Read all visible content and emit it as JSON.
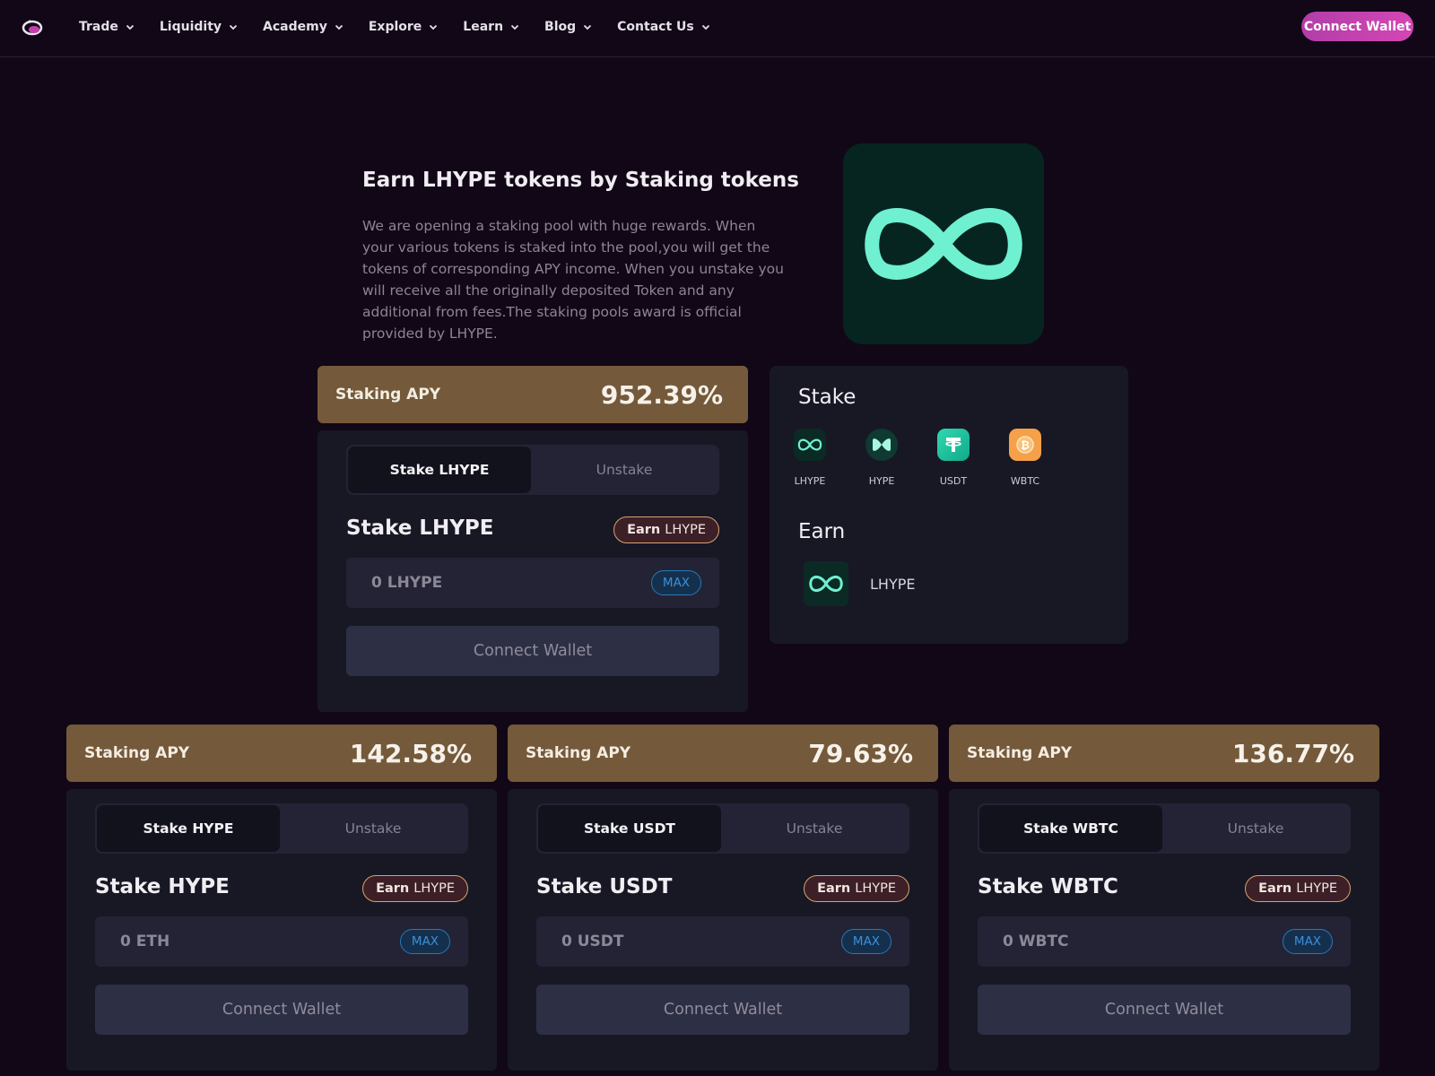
{
  "nav": {
    "items": [
      "Trade",
      "Liquidity",
      "Academy",
      "Explore",
      "Learn",
      "Blog",
      "Contact Us"
    ],
    "connect_label": "Connect Wallet"
  },
  "hero": {
    "title": "Earn LHYPE tokens by Staking tokens",
    "description": "We are opening a staking pool with huge rewards. When your various tokens is staked into the pool,you will get the tokens of corresponding APY income. When you unstake you will receive all the originally deposited Token and any additional from fees.The staking pools award is official provided by LHYPE."
  },
  "pools": [
    {
      "apy_label": "Staking APY",
      "apy_value": "952.39%",
      "tab_stake": "Stake LHYPE",
      "tab_unstake": "Unstake",
      "title": "Stake LHYPE",
      "earn_strong": "Earn",
      "earn_token": "LHYPE",
      "placeholder": "0 LHYPE",
      "max_label": "MAX",
      "button": "Connect Wallet"
    },
    {
      "apy_label": "Staking APY",
      "apy_value": "142.58%",
      "tab_stake": "Stake HYPE",
      "tab_unstake": "Unstake",
      "title": "Stake HYPE",
      "earn_strong": "Earn",
      "earn_token": "LHYPE",
      "placeholder": "0 ETH",
      "max_label": "MAX",
      "button": "Connect Wallet"
    },
    {
      "apy_label": "Staking APY",
      "apy_value": "79.63%",
      "tab_stake": "Stake USDT",
      "tab_unstake": "Unstake",
      "title": "Stake USDT",
      "earn_strong": "Earn",
      "earn_token": "LHYPE",
      "placeholder": "0 USDT",
      "max_label": "MAX",
      "button": "Connect Wallet"
    },
    {
      "apy_label": "Staking APY",
      "apy_value": "136.77%",
      "tab_stake": "Stake WBTC",
      "tab_unstake": "Unstake",
      "title": "Stake WBTC",
      "earn_strong": "Earn",
      "earn_token": "LHYPE",
      "placeholder": "0 WBTC",
      "max_label": "MAX",
      "button": "Connect Wallet"
    }
  ],
  "info": {
    "stake_heading": "Stake",
    "tokens": [
      {
        "name": "LHYPE",
        "icon": "lhype-infinity-icon"
      },
      {
        "name": "HYPE",
        "icon": "hype-icon"
      },
      {
        "name": "USDT",
        "icon": "usdt-tether-icon"
      },
      {
        "name": "WBTC",
        "icon": "wbtc-bitcoin-icon"
      }
    ],
    "earn_heading": "Earn",
    "earn_token": "LHYPE"
  },
  "colors": {
    "background": "#110716",
    "card": "#181825",
    "apy_header": "#74593a",
    "accent_pink": "#c43fae",
    "lhype_mint": "#6ff0d0"
  }
}
